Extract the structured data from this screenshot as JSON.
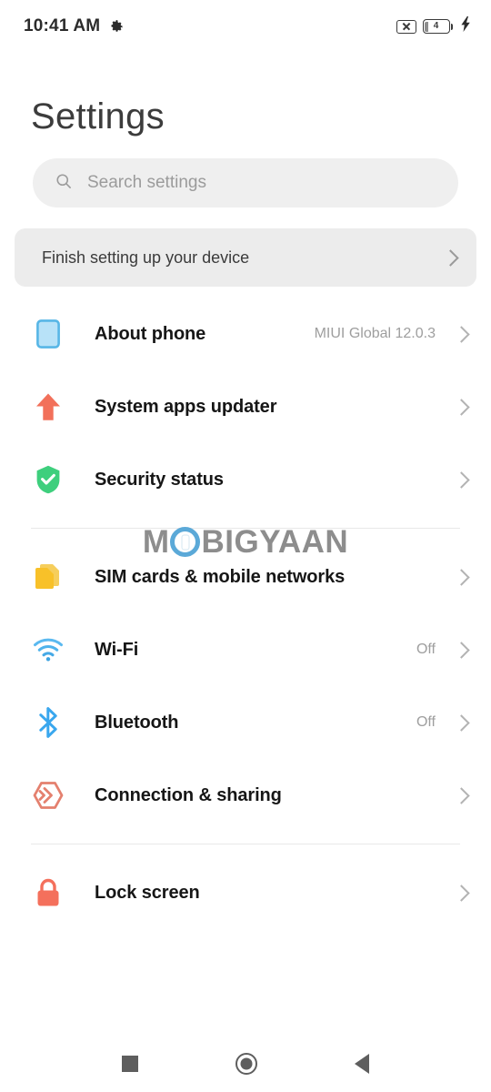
{
  "statusbar": {
    "clock": "10:41 AM",
    "gear_icon": "gear-icon",
    "sim_off_icon": "sim-disabled-icon",
    "battery_level": "4",
    "battery_icon": "battery-icon",
    "charging_icon": "charging-bolt-icon"
  },
  "header": {
    "title": "Settings"
  },
  "search": {
    "icon": "search-icon",
    "placeholder": "Search settings",
    "value": ""
  },
  "banner": {
    "label": "Finish setting up your device",
    "chevron": "chevron-right-icon"
  },
  "sections": [
    {
      "items": [
        {
          "label": "About phone",
          "value": "MIUI Global 12.0.3",
          "icon": "phone-outline-icon",
          "color": "#a9daf5"
        },
        {
          "label": "System apps updater",
          "value": "",
          "icon": "up-arrow-icon",
          "color": "#f2705a"
        },
        {
          "label": "Security status",
          "value": "",
          "icon": "shield-check-icon",
          "color": "#3ecf7d"
        }
      ]
    },
    {
      "items": [
        {
          "label": "SIM cards & mobile networks",
          "value": "",
          "icon": "sim-cards-icon",
          "color": "#f6c23c"
        },
        {
          "label": "Wi-Fi",
          "value": "Off",
          "icon": "wifi-icon",
          "color": "#4eb3ec"
        },
        {
          "label": "Bluetooth",
          "value": "Off",
          "icon": "bluetooth-icon",
          "color": "#3aa7ee"
        },
        {
          "label": "Connection & sharing",
          "value": "",
          "icon": "connection-sharing-icon",
          "color": "#e4806e"
        }
      ]
    },
    {
      "items": [
        {
          "label": "Lock screen",
          "value": "",
          "icon": "lock-icon",
          "color": "#f4705c"
        }
      ]
    }
  ],
  "watermark": {
    "prefix": "M",
    "suffix": "BIGYAAN",
    "color": "#8d8d8d",
    "accent": "#5ba9d8"
  },
  "navbar": {
    "recents": "recents-square-icon",
    "home": "home-circle-icon",
    "back": "back-triangle-icon"
  }
}
